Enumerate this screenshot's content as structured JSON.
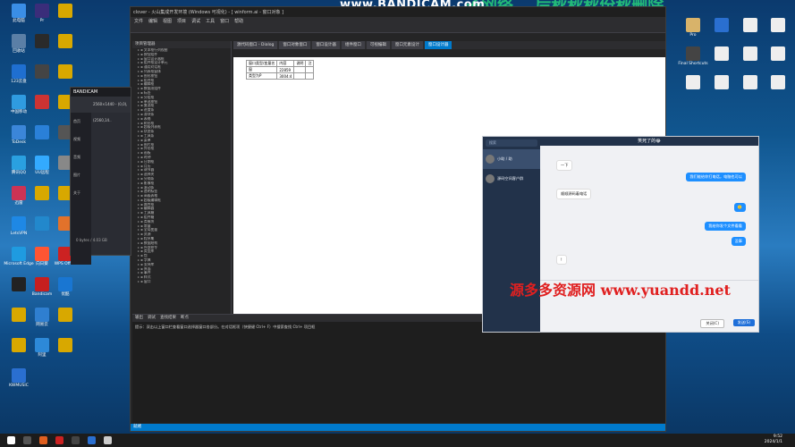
{
  "watermark": {
    "bandicam": "www.BANDICAM.com",
    "site": "源多多资源网 www.yuandd.net",
    "top_green": "子网络，  后秋秋秋份秋删除"
  },
  "desktop_left": [
    {
      "label": "此电脑",
      "color": "#3a8ee6"
    },
    {
      "label": "Pr",
      "color": "#3a2d7a"
    },
    {
      "label": "",
      "color": "#d8a800"
    },
    {
      "label": "回收站",
      "color": "#5b7fa6"
    },
    {
      "label": "",
      "color": "#2a2a2a"
    },
    {
      "label": "",
      "color": "#d8a800"
    },
    {
      "label": "123云盘",
      "color": "#1f6fd0"
    },
    {
      "label": "",
      "color": "#444"
    },
    {
      "label": "",
      "color": "#d8a800"
    },
    {
      "label": "中国移动",
      "color": "#2f9be0"
    },
    {
      "label": "",
      "color": "#c33"
    },
    {
      "label": "",
      "color": "#d8a800"
    },
    {
      "label": "ToDesk",
      "color": "#3b86d9"
    },
    {
      "label": "",
      "color": "#2a80d8"
    },
    {
      "label": "",
      "color": "#555"
    },
    {
      "label": "腾讯QQ",
      "color": "#2aa0e0"
    },
    {
      "label": "UU远程",
      "color": "#33aaff"
    },
    {
      "label": "",
      "color": "#888"
    },
    {
      "label": "迅雷",
      "color": "#cc3355"
    },
    {
      "label": "",
      "color": "#d8a800"
    },
    {
      "label": "",
      "color": "#d8a800"
    },
    {
      "label": "LetsVPN",
      "color": "#1e88e5"
    },
    {
      "label": "",
      "color": "#2288cc"
    },
    {
      "label": "",
      "color": "#e2722b"
    },
    {
      "label": "Microsoft Edge",
      "color": "#1f9be0"
    },
    {
      "label": "向日葵",
      "color": "#ff5533"
    },
    {
      "label": "WPS Office",
      "color": "#cc2222"
    },
    {
      "label": "",
      "color": "#222"
    },
    {
      "label": "Bandicam",
      "color": "#c61f1f"
    },
    {
      "label": "优酷",
      "color": "#1976d2"
    },
    {
      "label": "",
      "color": "#d8a800"
    },
    {
      "label": "网易云",
      "color": "#2f7fd0"
    },
    {
      "label": "",
      "color": "#d8a800"
    },
    {
      "label": "",
      "color": "#d8a800"
    },
    {
      "label": "阿里",
      "color": "#2d89d8"
    },
    {
      "label": "",
      "color": "#d8a800"
    },
    {
      "label": "KWMUSIC",
      "color": "#2a6fd0"
    }
  ],
  "desktop_right": [
    {
      "label": "Pro",
      "color": "#d8b36a"
    },
    {
      "label": "",
      "color": "#2a6fd0"
    },
    {
      "label": "",
      "color": "#eee"
    },
    {
      "label": "",
      "color": "#eee"
    },
    {
      "label": "Final Shortcuts",
      "color": "#444"
    },
    {
      "label": "",
      "color": "#eee"
    },
    {
      "label": "",
      "color": "#eee"
    },
    {
      "label": "",
      "color": "#eee"
    },
    {
      "label": "",
      "color": "#eee"
    },
    {
      "label": "",
      "color": "#eee"
    },
    {
      "label": "",
      "color": "#eee"
    },
    {
      "label": "",
      "color": "#eee"
    }
  ],
  "ide": {
    "title": "clover - 火山集成开发环境 (Windows 可视化) - [ winform.ai - 窗口对象 ]",
    "menus": [
      "文件",
      "编辑",
      "视图",
      "项目",
      "调试",
      "工具",
      "窗口",
      "帮助"
    ],
    "tabs": [
      "源代码窗口 - Dialog",
      "窗口对象窗口",
      "窗口设计器",
      "组件窗口",
      "可视编辑",
      "窗口元素设计",
      "窗口设计器"
    ],
    "tree_header": "项目管理器",
    "tree_rows": [
      "文本框行列视图",
      "按钮组件",
      "窗口设计器框",
      "组件框设计单元",
      "通用对话框",
      "列表框窗体",
      "图形按钮",
      "组合框",
      "编辑框",
      "数据项组件",
      "标签",
      "分组框",
      "单选按钮",
      "复选框",
      "进度条",
      "滑块条",
      "表格",
      "树形框",
      "超级列表框",
      "状态条",
      "工具条",
      "菜单",
      "图片框",
      "外形框",
      "画板",
      "时钟",
      "日期框",
      "月历",
      "调节器",
      "选择夹",
      "分隔条",
      "影像框",
      "滚动条",
      "透明标签",
      "高级表格",
      "超级编辑框",
      "属性框",
      "编辑器",
      "工具箱",
      "组件箱",
      "类模块",
      "常量",
      "全局变量",
      "资源",
      "程序集",
      "数据结构",
      "外部命令",
      "类型库",
      "包",
      "字典",
      "支持库",
      "界面",
      "事件",
      "样式",
      "窗口"
    ],
    "grid": [
      [
        "窗口类型/变量名",
        "内容",
        "说明",
        "注"
      ],
      [
        "窗",
        "22859",
        "",
        ""
      ],
      [
        "类型为P",
        "3004:4",
        "",
        ""
      ]
    ],
    "bottom_tabs": [
      "输出",
      "调试",
      "查找结果",
      "断点"
    ],
    "output_text": "提示：双击以上窗口栏查看窗口选择器窗口各部分。在对话框项（快捷键 Ctrl+ F）中搜索查找 Ctrl+ 项目框",
    "status": "就绪"
  },
  "bandicam": {
    "title": "BANDICAM",
    "resolution": "2560×1440 - (0,0), (2560,14..",
    "menu": [
      "首页",
      "视频",
      "音频",
      "图片",
      "关于"
    ],
    "size": "0 bytes / 4.03 GB"
  },
  "chat": {
    "search_placeholder": "搜索",
    "title": "笑死了的😂",
    "conversations": [
      {
        "name": "小助 / 助"
      },
      {
        "name": "源码空间客户群"
      }
    ],
    "messages": [
      {
        "dir": "in",
        "text": "一下"
      },
      {
        "dir": "out",
        "text": "我们能给你打电话，电脑也可以"
      },
      {
        "dir": "in",
        "text": "顺顺源码着电话"
      },
      {
        "dir": "out",
        "text": "🙂"
      },
      {
        "dir": "out",
        "text": "我给你发个文件看看"
      },
      {
        "dir": "out",
        "text": "没事"
      },
      {
        "dir": "in",
        "text": "!"
      }
    ],
    "close_label": "关闭(C)",
    "send_label": "发送(S)"
  },
  "taskbar": {
    "time": "9:52",
    "date": "2024/1/1"
  }
}
